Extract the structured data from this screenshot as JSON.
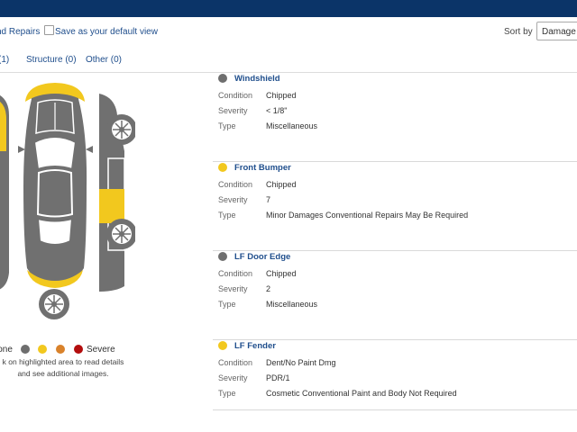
{
  "toolbar": {
    "link_text": "nd Repairs",
    "default_view_label": "Save as your default view",
    "sort_label": "Sort by",
    "sort_value": "Damage L"
  },
  "tabs": [
    {
      "label": "(1)"
    },
    {
      "label": "Structure (0)"
    },
    {
      "label": "Other (0)"
    }
  ],
  "legend": {
    "none_label": "None",
    "severe_label": "Severe",
    "dot_colors": [
      "#6e6e6e",
      "#f2c81e",
      "#d9822b",
      "#b30d0d"
    ],
    "hint_line1": "k on highlighted area to read details",
    "hint_line2": "and see additional images."
  },
  "colors": {
    "header_bg": "#0b3468",
    "link": "#1f4e8c",
    "car_body": "#707070",
    "damage_yellow": "#f2c81e"
  },
  "damages": [
    {
      "title": "Windshield",
      "dot_color": "#6e6e6e",
      "condition_label": "Condition",
      "condition": "Chipped",
      "severity_label": "Severity",
      "severity": "< 1/8\"",
      "type_label": "Type",
      "type": "Miscellaneous"
    },
    {
      "title": "Front Bumper",
      "dot_color": "#f2c81e",
      "condition_label": "Condition",
      "condition": "Chipped",
      "severity_label": "Severity",
      "severity": "7",
      "type_label": "Type",
      "type": "Minor Damages Conventional Repairs May Be Required"
    },
    {
      "title": "LF Door Edge",
      "dot_color": "#6e6e6e",
      "condition_label": "Condition",
      "condition": "Chipped",
      "severity_label": "Severity",
      "severity": "2",
      "type_label": "Type",
      "type": "Miscellaneous"
    },
    {
      "title": "LF Fender",
      "dot_color": "#f2c81e",
      "condition_label": "Condition",
      "condition": "Dent/No Paint Dmg",
      "severity_label": "Severity",
      "severity": "PDR/1",
      "type_label": "Type",
      "type": "Cosmetic Conventional Paint and Body Not Required"
    }
  ]
}
